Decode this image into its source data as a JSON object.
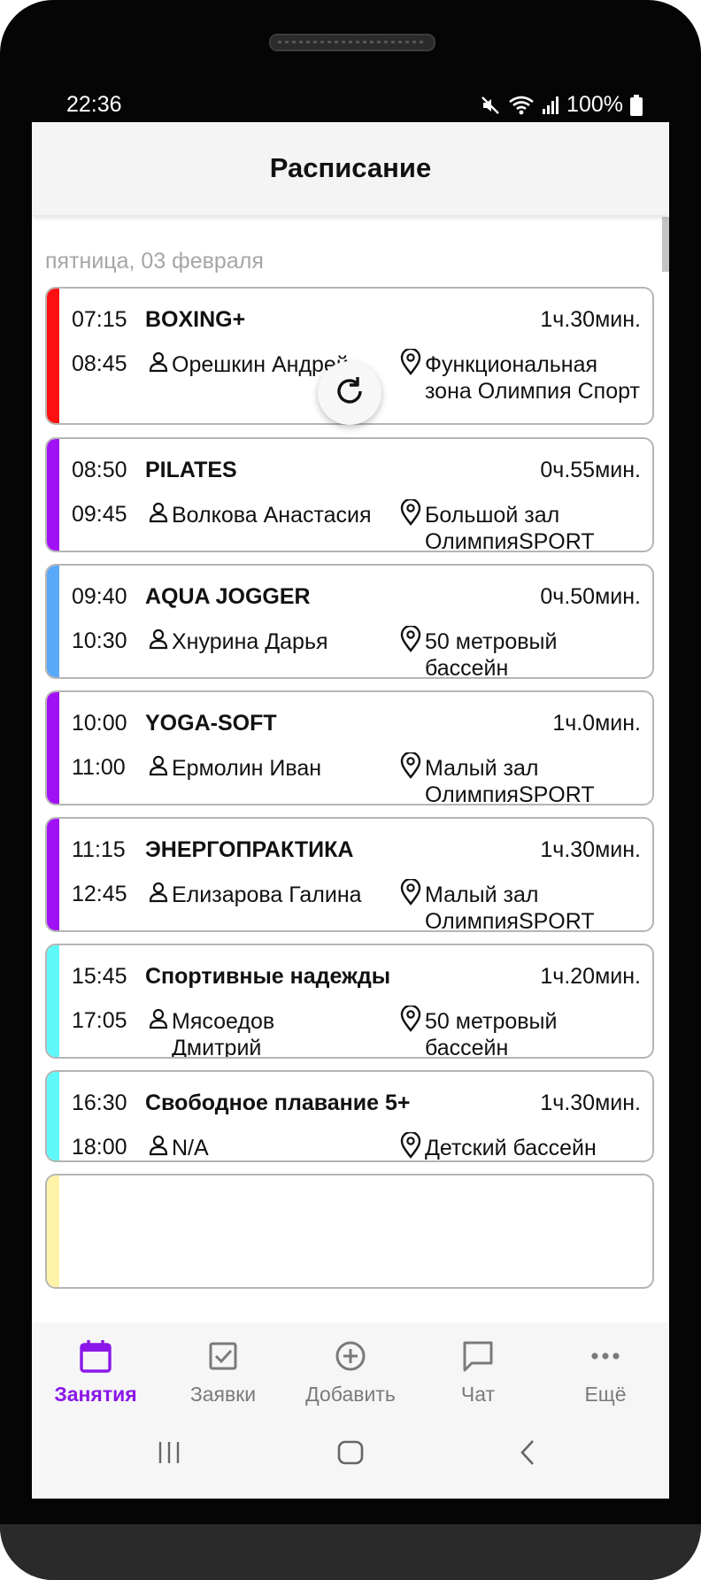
{
  "status_bar": {
    "time": "22:36",
    "battery": "100%"
  },
  "app_bar": {
    "title": "Расписание"
  },
  "date_header": "пятница, 03 февраля",
  "classes": [
    {
      "start": "07:15",
      "end": "08:45",
      "name": "BOXING+",
      "duration": "1ч.30мин.",
      "trainer": "Орешкин Андрей",
      "location": "Функциональная зона Олимпия Спорт",
      "color": "#ff1010"
    },
    {
      "start": "08:50",
      "end": "09:45",
      "name": "PILATES",
      "duration": "0ч.55мин.",
      "trainer": "Волкова Анастасия",
      "location": "Большой зал ОлимпияSPORT",
      "color": "#a012f5"
    },
    {
      "start": "09:40",
      "end": "10:30",
      "name": "AQUA JOGGER",
      "duration": "0ч.50мин.",
      "trainer": "Хнурина Дарья",
      "location": "50 метровый бассейн",
      "color": "#5aa8f8"
    },
    {
      "start": "10:00",
      "end": "11:00",
      "name": "YOGA-SOFT",
      "duration": "1ч.0мин.",
      "trainer": "Ермолин Иван",
      "location": "Малый зал ОлимпияSPORT",
      "color": "#a012f5"
    },
    {
      "start": "11:15",
      "end": "12:45",
      "name": "ЭНЕРГОПРАКТИКА",
      "duration": "1ч.30мин.",
      "trainer": "Елизарова Галина",
      "location": "Малый зал ОлимпияSPORT",
      "color": "#a012f5"
    },
    {
      "start": "15:45",
      "end": "17:05",
      "name": "Спортивные надежды",
      "duration": "1ч.20мин.",
      "trainer": "Мясоедов Дмитрий",
      "location": "50 метровый бассейн",
      "color": "#5ff8f8"
    },
    {
      "start": "16:30",
      "end": "18:00",
      "name": "Свободное плавание 5+",
      "duration": "1ч.30мин.",
      "trainer": "N/A",
      "location": "Детский бассейн",
      "color": "#5ff8f8"
    },
    {
      "start": "",
      "end": "",
      "name": "",
      "duration": "",
      "trainer": "",
      "location": "",
      "color": "#fff3a8"
    }
  ],
  "bottom_nav": {
    "items": [
      {
        "label": "Занятия",
        "icon": "calendar-icon",
        "active": true
      },
      {
        "label": "Заявки",
        "icon": "checkbox-icon",
        "active": false
      },
      {
        "label": "Добавить",
        "icon": "add-circle-icon",
        "active": false
      },
      {
        "label": "Чат",
        "icon": "chat-icon",
        "active": false
      },
      {
        "label": "Ещё",
        "icon": "more-icon",
        "active": false
      }
    ]
  },
  "colors": {
    "accent": "#8a17e8",
    "inactive": "#7a7a7a"
  }
}
